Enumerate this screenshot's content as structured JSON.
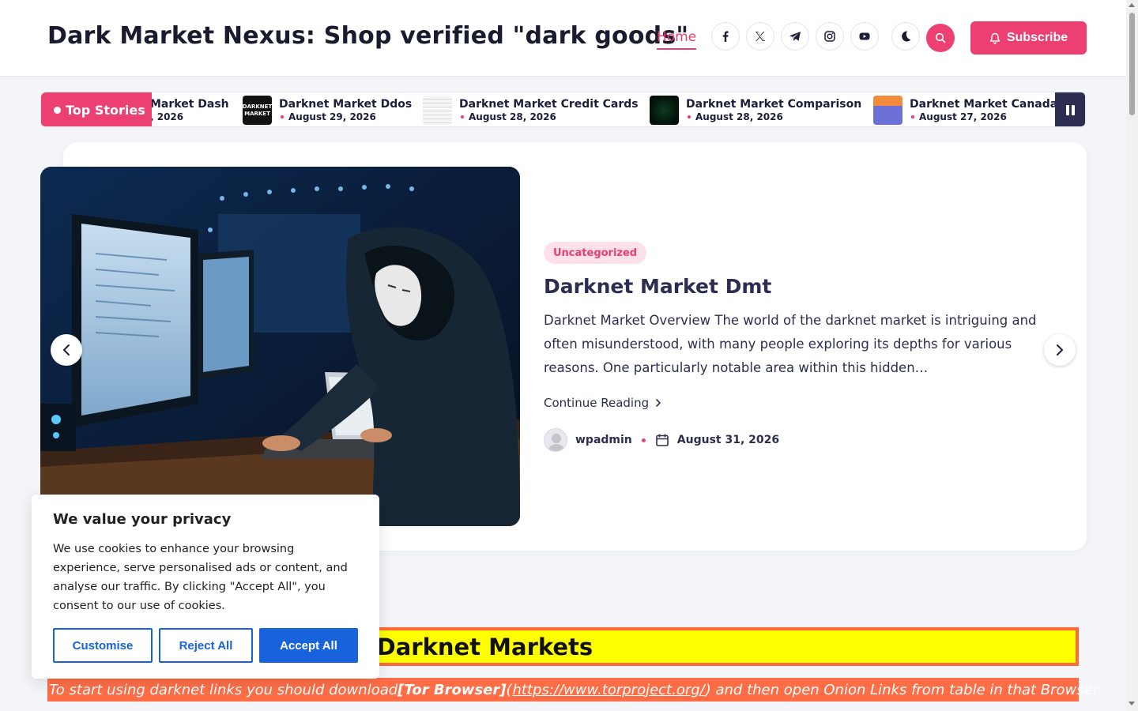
{
  "header": {
    "site_title": "Dark Market Nexus: Shop verified \"dark goods\"",
    "nav_home": "Home",
    "subscribe_label": "Subscribe",
    "social_icons": [
      "facebook-icon",
      "x-twitter-icon",
      "telegram-icon",
      "instagram-icon",
      "youtube-icon"
    ]
  },
  "ticker": {
    "label": "Top Stories",
    "items": [
      {
        "title": "Market Dash",
        "date": ", 2026"
      },
      {
        "title": "Darknet Market Ddos",
        "date": "August 29, 2026"
      },
      {
        "title": "Darknet Market Credit Cards",
        "date": "August 28, 2026"
      },
      {
        "title": "Darknet Market Comparison",
        "date": "August 28, 2026"
      },
      {
        "title": "Darknet Market Canada",
        "date": "August 27, 2026"
      }
    ]
  },
  "hero": {
    "category": "Uncategorized",
    "title": "Darknet Market Dmt",
    "excerpt": "Darknet Market Overview The world of the darknet market is intriguing and often misunderstood, with many people exploring its depths for various reasons. One particularly notable area within this hidden…",
    "continue_label": "Continue Reading",
    "author": "wpadmin",
    "date": "August 31, 2026"
  },
  "content": {
    "list_banner": "The Full List of Trusted Darknet Markets",
    "tor_prefix": "To start using darknet links you should download ",
    "tor_bold": "[Tor Browser]",
    "tor_paren_open": " (",
    "tor_link": "https://www.torproject.org/",
    "tor_suffix": ") and then open Onion Links from table in that Browser"
  },
  "cookie": {
    "title": "We value your privacy",
    "text": "We use cookies to enhance your browsing experience, serve personalised ads or content, and analyse our traffic. By clicking \"Accept All\", you consent to our use of cookies.",
    "customise": "Customise",
    "reject": "Reject All",
    "accept": "Accept All"
  },
  "colors": {
    "accent": "#ec3f72",
    "navy": "#2d2d52",
    "cookie_blue": "#1863dc",
    "banner_yellow": "#ffff00",
    "banner_orange": "#ff6d46"
  }
}
